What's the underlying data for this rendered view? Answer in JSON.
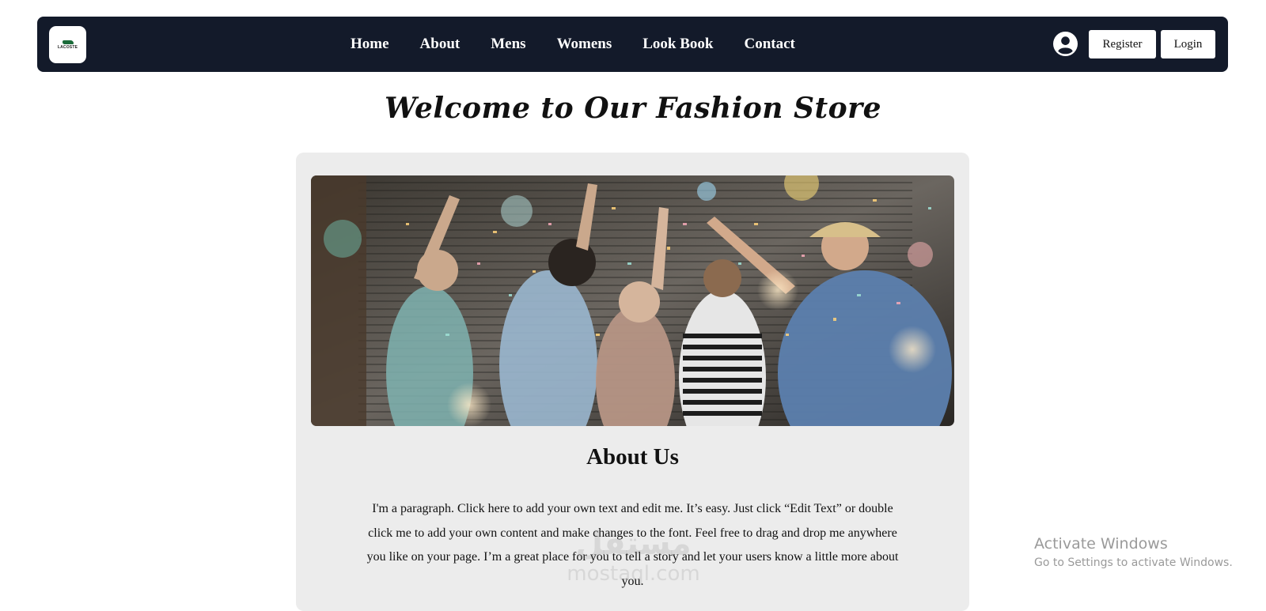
{
  "header": {
    "logo_text": "LACOSTE",
    "nav_items": [
      "Home",
      "About",
      "Mens",
      "Womens",
      "Look Book",
      "Contact"
    ],
    "register_label": "Register",
    "login_label": "Login"
  },
  "main": {
    "welcome_title": "Welcome to Our Fashion Store",
    "about_title": "About Us",
    "about_text": "I'm a paragraph. Click here to add your own text and edit me. It’s easy. Just click “Edit Text” or double click me to add your own content and make changes to the font. Feel free to drag and drop me anywhere you like on your page. I’m a great place for you to tell a story and let your users know a little more about you."
  },
  "watermark": {
    "arabic": "مستقل",
    "domain": "mostaql.com"
  },
  "os_overlay": {
    "activate_title": "Activate Windows",
    "activate_subtitle": "Go to Settings to activate Windows."
  },
  "colors": {
    "nav_bg": "#131a2a",
    "card_bg": "#ececec",
    "page_bg": "#ffffff"
  },
  "icons": {
    "account": "user-circle-icon"
  }
}
